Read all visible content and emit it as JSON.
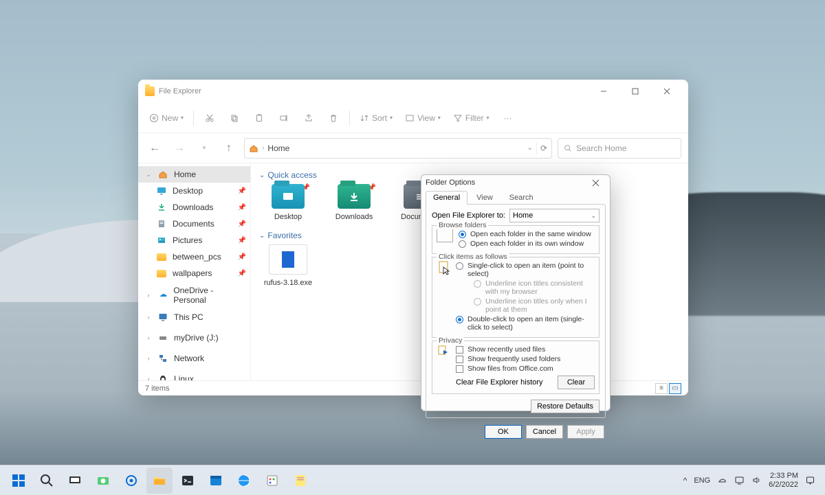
{
  "explorer": {
    "title": "File Explorer",
    "toolbar": {
      "new": "New",
      "sort": "Sort",
      "view": "View",
      "filter": "Filter"
    },
    "breadcrumb": "Home",
    "search_placeholder": "Search Home",
    "sidebar": {
      "home": "Home",
      "desktop": "Desktop",
      "downloads": "Downloads",
      "documents": "Documents",
      "pictures": "Pictures",
      "between_pcs": "between_pcs",
      "wallpapers": "wallpapers",
      "onedrive": "OneDrive - Personal",
      "thispc": "This PC",
      "mydrive": "myDrive (J:)",
      "network": "Network",
      "linux": "Linux"
    },
    "sections": {
      "quick_access": "Quick access",
      "favorites": "Favorites"
    },
    "quick_access_items": {
      "desktop": "Desktop",
      "downloads": "Downloads",
      "documents": "Documents"
    },
    "favorite_items": {
      "rufus": "rufus-3.18.exe"
    },
    "status": "7 items"
  },
  "dialog": {
    "title": "Folder Options",
    "tabs": {
      "general": "General",
      "view": "View",
      "search": "Search"
    },
    "open_label": "Open File Explorer to:",
    "open_value": "Home",
    "group_browse": "Browse folders",
    "opt_same_window": "Open each folder in the same window",
    "opt_own_window": "Open each folder in its own window",
    "group_click": "Click items as follows",
    "opt_single_click": "Single-click to open an item (point to select)",
    "opt_underline_browser": "Underline icon titles consistent with my browser",
    "opt_underline_point": "Underline icon titles only when I point at them",
    "opt_double_click": "Double-click to open an item (single-click to select)",
    "group_privacy": "Privacy",
    "opt_recent": "Show recently used files",
    "opt_frequent": "Show frequently used folders",
    "opt_office": "Show files from Office.com",
    "clear_label": "Clear File Explorer history",
    "btn_clear": "Clear",
    "btn_restore": "Restore Defaults",
    "btn_ok": "OK",
    "btn_cancel": "Cancel",
    "btn_apply": "Apply"
  },
  "taskbar": {
    "lang": "ENG",
    "time": "2:33 PM",
    "date": "6/2/2022"
  }
}
